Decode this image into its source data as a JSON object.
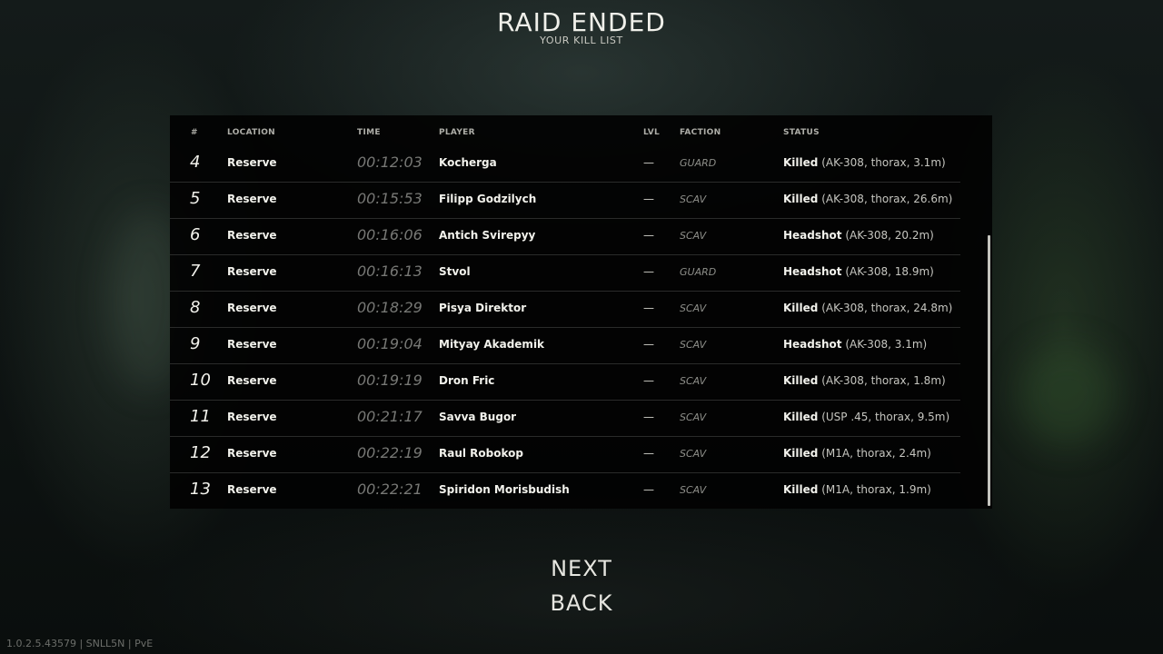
{
  "header": {
    "title": "RAID ENDED",
    "subtitle": "YOUR KILL LIST"
  },
  "table": {
    "columns": {
      "num": "#",
      "location": "LOCATION",
      "time": "TIME",
      "player": "PLAYER",
      "lvl": "LVL",
      "faction": "FACTION",
      "status": "STATUS"
    },
    "rows": [
      {
        "num": "4",
        "location": "Reserve",
        "time": "00:12:03",
        "player": "Kocherga",
        "lvl": "—",
        "faction": "GUARD",
        "status_word": "Killed",
        "status_detail": "(AK-308, thorax, 3.1m)"
      },
      {
        "num": "5",
        "location": "Reserve",
        "time": "00:15:53",
        "player": "Filipp Godzilych",
        "lvl": "—",
        "faction": "SCAV",
        "status_word": "Killed",
        "status_detail": "(AK-308, thorax, 26.6m)"
      },
      {
        "num": "6",
        "location": "Reserve",
        "time": "00:16:06",
        "player": "Antich Svirepyy",
        "lvl": "—",
        "faction": "SCAV",
        "status_word": "Headshot",
        "status_detail": "(AK-308, 20.2m)"
      },
      {
        "num": "7",
        "location": "Reserve",
        "time": "00:16:13",
        "player": "Stvol",
        "lvl": "—",
        "faction": "GUARD",
        "status_word": "Headshot",
        "status_detail": "(AK-308, 18.9m)"
      },
      {
        "num": "8",
        "location": "Reserve",
        "time": "00:18:29",
        "player": "Pisya Direktor",
        "lvl": "—",
        "faction": "SCAV",
        "status_word": "Killed",
        "status_detail": "(AK-308, thorax, 24.8m)"
      },
      {
        "num": "9",
        "location": "Reserve",
        "time": "00:19:04",
        "player": "Mityay Akademik",
        "lvl": "—",
        "faction": "SCAV",
        "status_word": "Headshot",
        "status_detail": "(AK-308, 3.1m)"
      },
      {
        "num": "10",
        "location": "Reserve",
        "time": "00:19:19",
        "player": "Dron Fric",
        "lvl": "—",
        "faction": "SCAV",
        "status_word": "Killed",
        "status_detail": "(AK-308, thorax, 1.8m)"
      },
      {
        "num": "11",
        "location": "Reserve",
        "time": "00:21:17",
        "player": "Savva Bugor",
        "lvl": "—",
        "faction": "SCAV",
        "status_word": "Killed",
        "status_detail": "(USP .45, thorax, 9.5m)"
      },
      {
        "num": "12",
        "location": "Reserve",
        "time": "00:22:19",
        "player": "Raul Robokop",
        "lvl": "—",
        "faction": "SCAV",
        "status_word": "Killed",
        "status_detail": "(M1A, thorax, 2.4m)"
      },
      {
        "num": "13",
        "location": "Reserve",
        "time": "00:22:21",
        "player": "Spiridon Morisbudish",
        "lvl": "—",
        "faction": "SCAV",
        "status_word": "Killed",
        "status_detail": "(M1A, thorax, 1.9m)"
      }
    ]
  },
  "buttons": {
    "next": "NEXT",
    "back": "BACK"
  },
  "footer": {
    "version": "1.0.2.5.43579 | SNLL5N | PvE"
  }
}
